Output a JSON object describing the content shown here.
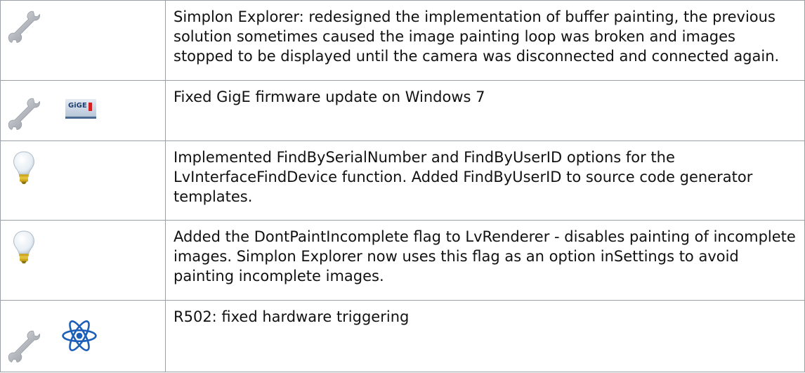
{
  "rows": [
    {
      "icons": [
        "wrench-icon"
      ],
      "text": "Simplon Explorer: redesigned the implementation of buffer painting, the previous solution sometimes caused the image painting loop was broken and images stopped to be displayed until the camera was disconnected and connected again."
    },
    {
      "icons": [
        "wrench-icon",
        "gige-icon"
      ],
      "text": "Fixed GigE firmware update on Windows 7",
      "gige_label": "GiGE"
    },
    {
      "icons": [
        "lightbulb-icon"
      ],
      "text": "Implemented FindBySerialNumber and FindByUserID options for the LvInterfaceFindDevice function. Added FindByUserID to source code generator templates."
    },
    {
      "icons": [
        "lightbulb-icon"
      ],
      "text": "Added the DontPaintIncomplete flag to LvRenderer - disables painting of incomplete images. Simplon Explorer now uses this flag as an option inSettings to avoid painting incomplete images."
    },
    {
      "icons": [
        "wrench-icon",
        "atom-icon"
      ],
      "text": "R502: fixed hardware triggering"
    }
  ],
  "colors": {
    "border": "#9aa0a6",
    "text": "#111111",
    "wrench": "#b8bcc2",
    "bulb": "#eef3f7",
    "bulb_base": "#d4b020",
    "atom": "#1d5fb8"
  }
}
